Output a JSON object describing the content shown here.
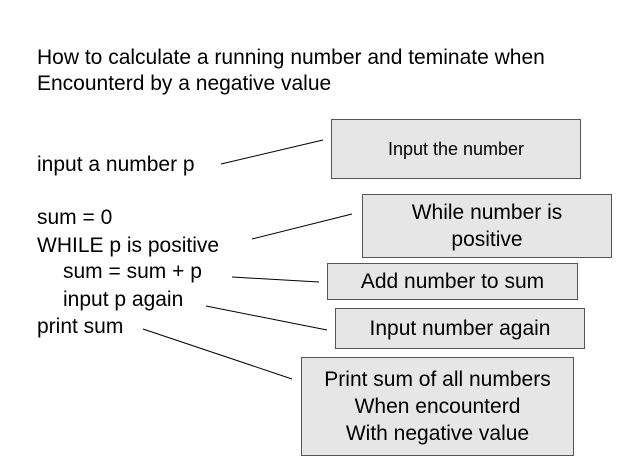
{
  "title": {
    "line1": "How to calculate a running number and teminate when",
    "line2": "Encounterd by a negative value"
  },
  "pseudocode": [
    "input a number p",
    "sum = 0",
    "WHILE p is positive",
    "sum = sum + p",
    "input p again",
    "print sum"
  ],
  "annotations": [
    "Input the number",
    "While number is\npositive",
    "Add number to sum",
    "Input number again",
    "Print sum of all numbers\nWhen encounterd\nWith negative value"
  ],
  "colors": {
    "box_fill": "#e6e6e6",
    "box_border": "#555555",
    "text": "#000000",
    "background": "#ffffff"
  }
}
